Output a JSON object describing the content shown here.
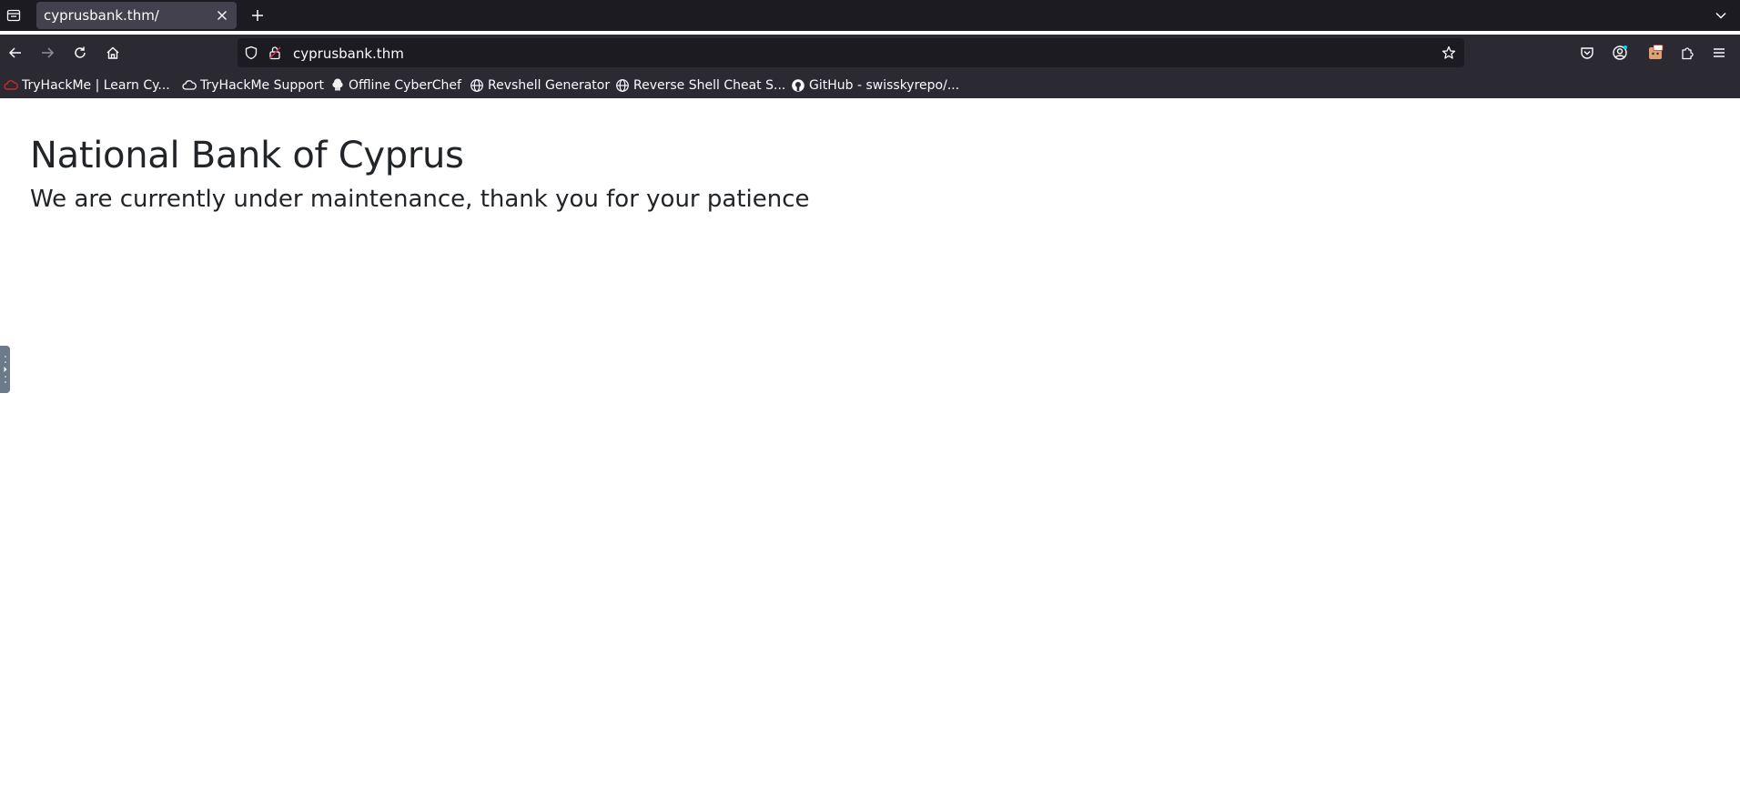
{
  "tab": {
    "title": "cyprusbank.thm/"
  },
  "urlbar": {
    "url": "cyprusbank.thm"
  },
  "bookmarks": [
    {
      "label": "TryHackMe | Learn Cy...",
      "icon": "tryhackme-icon"
    },
    {
      "label": "TryHackMe Support",
      "icon": "cloud-icon"
    },
    {
      "label": "Offline CyberChef",
      "icon": "chef-hat-icon"
    },
    {
      "label": "Revshell Generator",
      "icon": "globe-icon"
    },
    {
      "label": "Reverse Shell Cheat S...",
      "icon": "globe-icon"
    },
    {
      "label": "GitHub - swisskyrepo/...",
      "icon": "github-icon"
    }
  ],
  "page": {
    "title": "National Bank of Cyprus",
    "subtitle": "We are currently under maintenance, thank you for your patience"
  },
  "colors": {
    "tabstrip_bg": "#1c1b22",
    "toolbar_bg": "#2b2a33",
    "active_tab_bg": "#42414d",
    "page_text": "#212529"
  }
}
